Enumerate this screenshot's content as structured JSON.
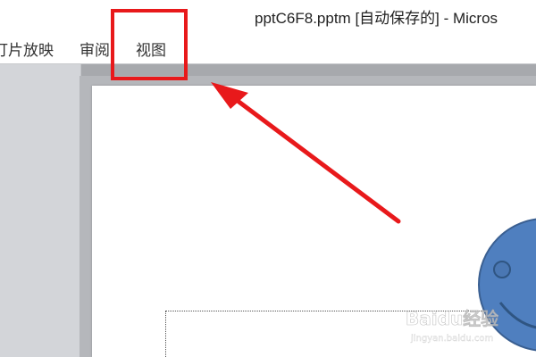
{
  "window": {
    "title": "pptC6F8.pptm [自动保存的]  -  Micros"
  },
  "ribbon": {
    "tabs": [
      {
        "label": "灯片放映"
      },
      {
        "label": "审阅"
      },
      {
        "label": "视图"
      }
    ]
  },
  "annotation": {
    "highlight_color": "#e8191b",
    "arrow_color": "#e8191b"
  },
  "slide": {
    "shape_color": "#4f7fbf",
    "shape_outline_color": "#3a5f91"
  },
  "watermark": {
    "brand": "Baidu经验",
    "url": "jingyan.baidu.com"
  }
}
